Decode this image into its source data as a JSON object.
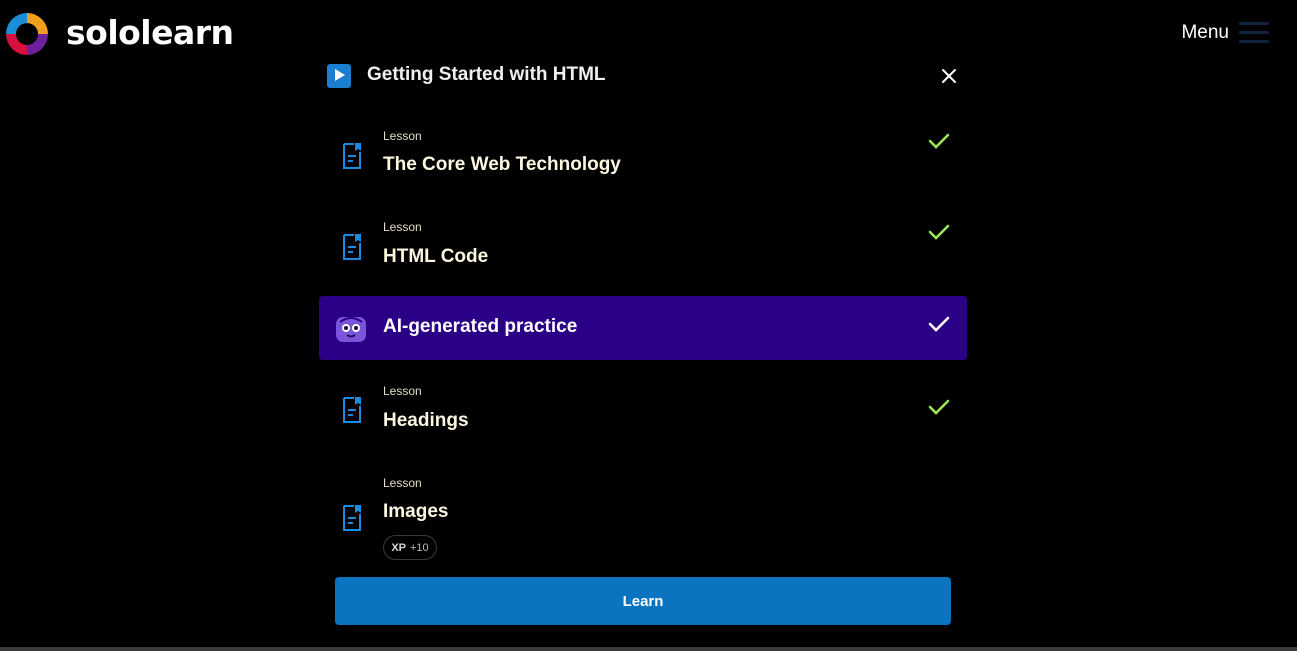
{
  "brand": {
    "name": "sololearn"
  },
  "header": {
    "menu_label": "Menu"
  },
  "module": {
    "title": "Getting Started with HTML"
  },
  "items": [
    {
      "type": "Lesson",
      "title": "The Core Web Technology",
      "completed": true,
      "icon": "lesson-doc-icon"
    },
    {
      "type": "Lesson",
      "title": "HTML Code",
      "completed": true,
      "icon": "lesson-doc-icon"
    },
    {
      "type": "",
      "title": "AI-generated practice",
      "completed": true,
      "active": true,
      "icon": "ai-bot-icon"
    },
    {
      "type": "Lesson",
      "title": "Headings",
      "completed": true,
      "icon": "lesson-doc-icon"
    },
    {
      "type": "Lesson",
      "title": "Images",
      "completed": false,
      "icon": "lesson-doc-icon"
    }
  ],
  "xp_badge": {
    "label": "XP",
    "value": "+10"
  },
  "learn_button": {
    "label": "Learn"
  },
  "colors": {
    "background": "#000000",
    "active_item": "#2a0087",
    "primary_button": "#0a74c0",
    "check_green": "#9ee35a",
    "lesson_icon": "#1b8be0"
  }
}
